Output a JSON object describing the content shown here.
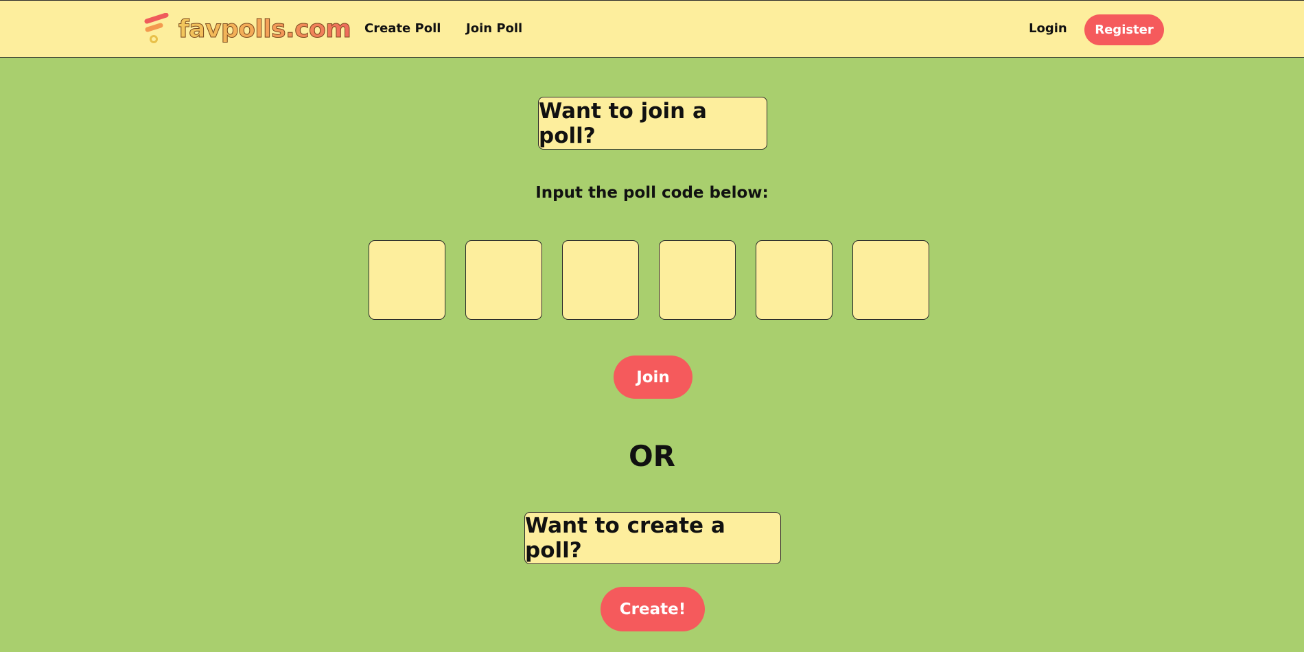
{
  "navbar": {
    "logo_text": "favpolls.com",
    "links": {
      "create_poll": "Create Poll",
      "join_poll": "Join Poll",
      "login": "Login",
      "register": "Register"
    }
  },
  "join_section": {
    "heading": "Want to join a poll?",
    "instruction": "Input the poll code below:",
    "code_boxes": [
      "",
      "",
      "",
      "",
      "",
      ""
    ],
    "join_button": "Join"
  },
  "separator": "OR",
  "create_section": {
    "heading": "Want to create a poll?",
    "create_button": "Create!"
  },
  "colors": {
    "background": "#a9cf6e",
    "panel": "#fdee9d",
    "accent": "#f55a5c",
    "logo_gradient_start": "#f2c85c",
    "logo_gradient_end": "#ef6b5b"
  }
}
